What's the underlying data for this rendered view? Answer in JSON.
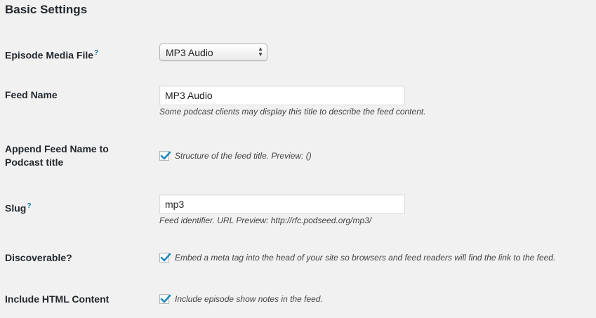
{
  "section": {
    "title": "Basic Settings"
  },
  "media_file": {
    "label": "Episode Media File",
    "help": "?",
    "selected": "MP3 Audio"
  },
  "feed_name": {
    "label": "Feed Name",
    "value": "MP3 Audio",
    "description": "Some podcast clients may display this title to describe the feed content."
  },
  "append_feed_name": {
    "label_line1": "Append Feed Name to",
    "label_line2": "Podcast title",
    "checked": true,
    "text": "Structure of the feed title. Preview: ()"
  },
  "slug": {
    "label": "Slug",
    "help": "?",
    "value": "mp3",
    "description": "Feed identifier. URL Preview: http://rfc.podseed.org/mp3/"
  },
  "discoverable": {
    "label": "Discoverable?",
    "checked": true,
    "text": "Embed a meta tag into the head of your site so browsers and feed readers will find the link to the feed."
  },
  "include_html": {
    "label": "Include HTML Content",
    "checked": true,
    "text": "Include episode show notes in the feed."
  },
  "colors": {
    "background": "#f1f1f1",
    "link": "#0073aa",
    "check": "#1e8cbe"
  }
}
